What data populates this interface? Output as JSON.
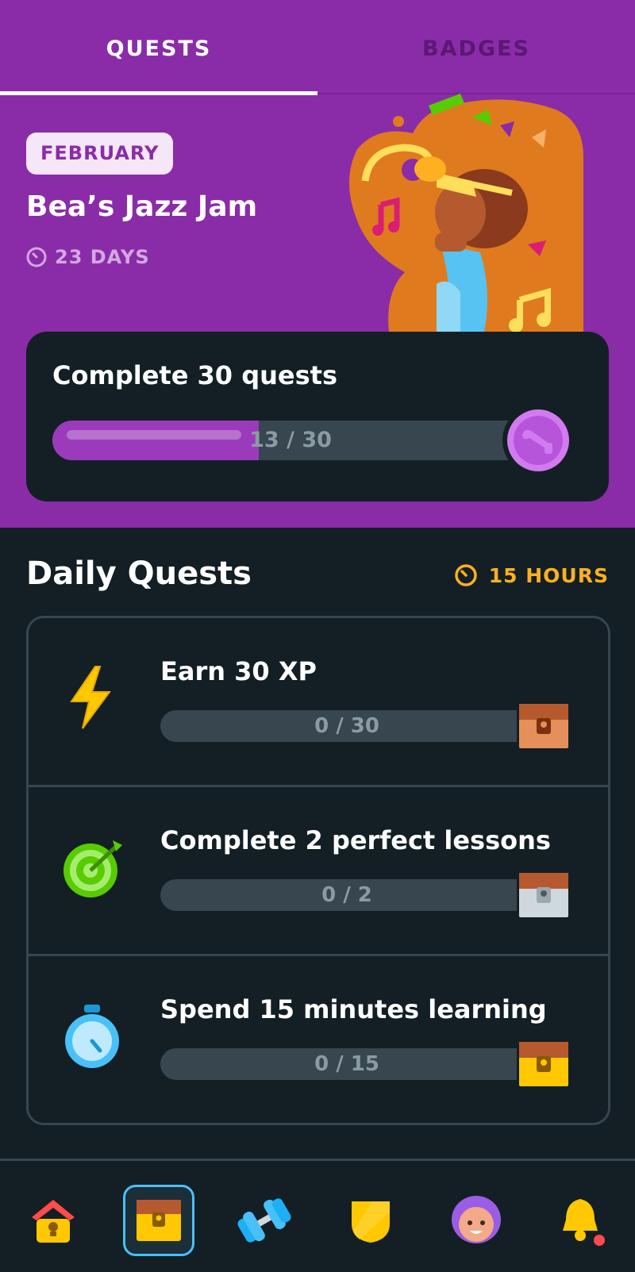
{
  "tabs": [
    {
      "label": "QUESTS",
      "active": true
    },
    {
      "label": "BADGES",
      "active": false
    }
  ],
  "event": {
    "month": "FEBRUARY",
    "title": "Bea’s Jazz Jam",
    "time_left": "23 DAYS",
    "time_icon": "clock-icon",
    "illustration": "jazz-trumpet-illustration"
  },
  "monthly_quest": {
    "label": "Complete 30 quests",
    "progress_text": "13 / 30",
    "current": 13,
    "goal": 30,
    "reward_icon": "trumpet-badge-icon"
  },
  "daily": {
    "title": "Daily Quests",
    "time_left": "15 HOURS",
    "quests": [
      {
        "label": "Earn 30 XP",
        "progress_text": "0 / 30",
        "current": 0,
        "goal": 30,
        "icon": "lightning-icon",
        "reward": "bronze-chest-icon"
      },
      {
        "label": "Complete 2 perfect lessons",
        "progress_text": "0 / 2",
        "current": 0,
        "goal": 2,
        "icon": "target-icon",
        "reward": "silver-chest-icon"
      },
      {
        "label": "Spend 15 minutes learning",
        "progress_text": "0 / 15",
        "current": 0,
        "goal": 15,
        "icon": "stopwatch-icon",
        "reward": "gold-chest-icon"
      }
    ]
  },
  "nav": [
    {
      "name": "home",
      "icon": "home-icon",
      "active": false
    },
    {
      "name": "quests",
      "icon": "chest-icon",
      "active": true
    },
    {
      "name": "practice",
      "icon": "dumbbell-icon",
      "active": false
    },
    {
      "name": "leagues",
      "icon": "shield-icon",
      "active": false
    },
    {
      "name": "profile",
      "icon": "avatar-icon",
      "active": false
    },
    {
      "name": "notifications",
      "icon": "bell-icon",
      "active": false,
      "has_dot": true
    }
  ],
  "colors": {
    "header_bg": "#8A2CA8",
    "page_bg": "#131F24",
    "progress_fill": "#9B3BBB",
    "timer_accent": "#FFB020",
    "active_nav_border": "#49C0F8"
  }
}
